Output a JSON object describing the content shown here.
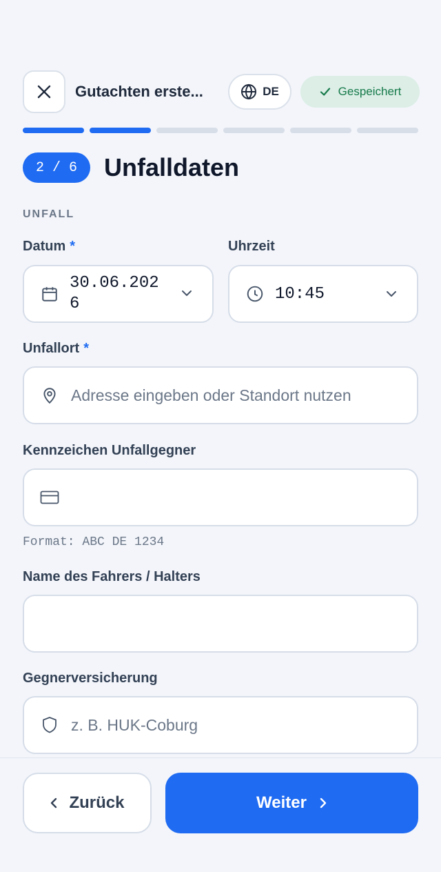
{
  "header": {
    "title": "Gutachten erste...",
    "language": "DE",
    "saved_label": "Gespeichert"
  },
  "progress": {
    "current_step": 2,
    "total_steps": 6
  },
  "step": {
    "badge": "2 / 6",
    "title": "Unfalldaten"
  },
  "section": {
    "label": "UNFALL"
  },
  "fields": {
    "date": {
      "label": "Datum",
      "required_mark": "*",
      "value_line1": "30.06.202",
      "value_line2": "6"
    },
    "time": {
      "label": "Uhrzeit",
      "value": "10:45"
    },
    "location": {
      "label": "Unfallort",
      "required_mark": "*",
      "placeholder": "Adresse eingeben oder Standort nutzen"
    },
    "plate": {
      "label": "Kennzeichen Unfallgegner",
      "value": "",
      "hint": "Format: ABC DE 1234"
    },
    "driver": {
      "label": "Name des Fahrers / Halters",
      "value": ""
    },
    "insurance": {
      "label": "Gegnerversicherung",
      "placeholder": "z. B. HUK-Coburg"
    }
  },
  "footer": {
    "back_label": "Zurück",
    "next_label": "Weiter"
  },
  "colors": {
    "accent": "#1f6bf2",
    "saved_bg": "#dceee6",
    "saved_text": "#177a4b"
  }
}
